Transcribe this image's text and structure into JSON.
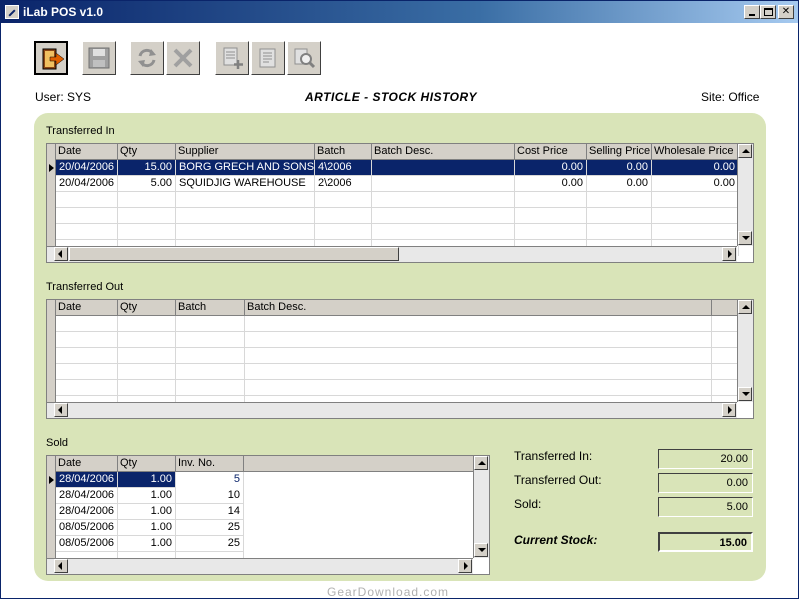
{
  "window": {
    "title": "iLab POS v1.0",
    "accent": "#0a246a"
  },
  "toolbar": {
    "buttons": [
      {
        "name": "exit-button",
        "icon": "exit-door-icon"
      },
      {
        "name": "save-button",
        "icon": "floppy-disk-icon"
      },
      {
        "name": "refresh-button",
        "icon": "refresh-icon"
      },
      {
        "name": "cancel-button",
        "icon": "cross-icon"
      },
      {
        "name": "add-item-button",
        "icon": "document-add-icon"
      },
      {
        "name": "edit-item-button",
        "icon": "document-edit-icon"
      },
      {
        "name": "search-button",
        "icon": "magnifier-icon"
      }
    ]
  },
  "info": {
    "user": "User: SYS",
    "title": "ARTICLE - STOCK HISTORY",
    "site": "Site: Office"
  },
  "panel_color": "#d9e4b8",
  "transferred_in": {
    "label": "Transferred In",
    "columns": [
      "Date",
      "Qty",
      "Supplier",
      "Batch",
      "Batch Desc.",
      "Cost Price",
      "Selling Price",
      "Wholesale Price"
    ],
    "rows": [
      [
        "20/04/2006",
        "15.00",
        "BORG GRECH AND SONS",
        "4\\2006",
        "",
        "0.00",
        "0.00",
        "0.00"
      ],
      [
        "20/04/2006",
        "5.00",
        "SQUIDJIG WAREHOUSE",
        "2\\2006",
        "",
        "0.00",
        "0.00",
        "0.00"
      ]
    ]
  },
  "transferred_out": {
    "label": "Transferred Out",
    "columns": [
      "Date",
      "Qty",
      "Batch",
      "Batch Desc."
    ],
    "rows": []
  },
  "sold": {
    "label": "Sold",
    "columns": [
      "Date",
      "Qty",
      "Inv. No."
    ],
    "rows": [
      [
        "28/04/2006",
        "1.00",
        "5"
      ],
      [
        "28/04/2006",
        "1.00",
        "10"
      ],
      [
        "28/04/2006",
        "1.00",
        "14"
      ],
      [
        "08/05/2006",
        "1.00",
        "25"
      ],
      [
        "08/05/2006",
        "1.00",
        "25"
      ]
    ]
  },
  "totals": {
    "transferred_in_label": "Transferred In:",
    "transferred_in_value": "20.00",
    "transferred_out_label": "Transferred Out:",
    "transferred_out_value": "0.00",
    "sold_label": "Sold:",
    "sold_value": "5.00",
    "current_stock_label": "Current Stock:",
    "current_stock_value": "15.00"
  },
  "watermark": "GearDownload.com"
}
